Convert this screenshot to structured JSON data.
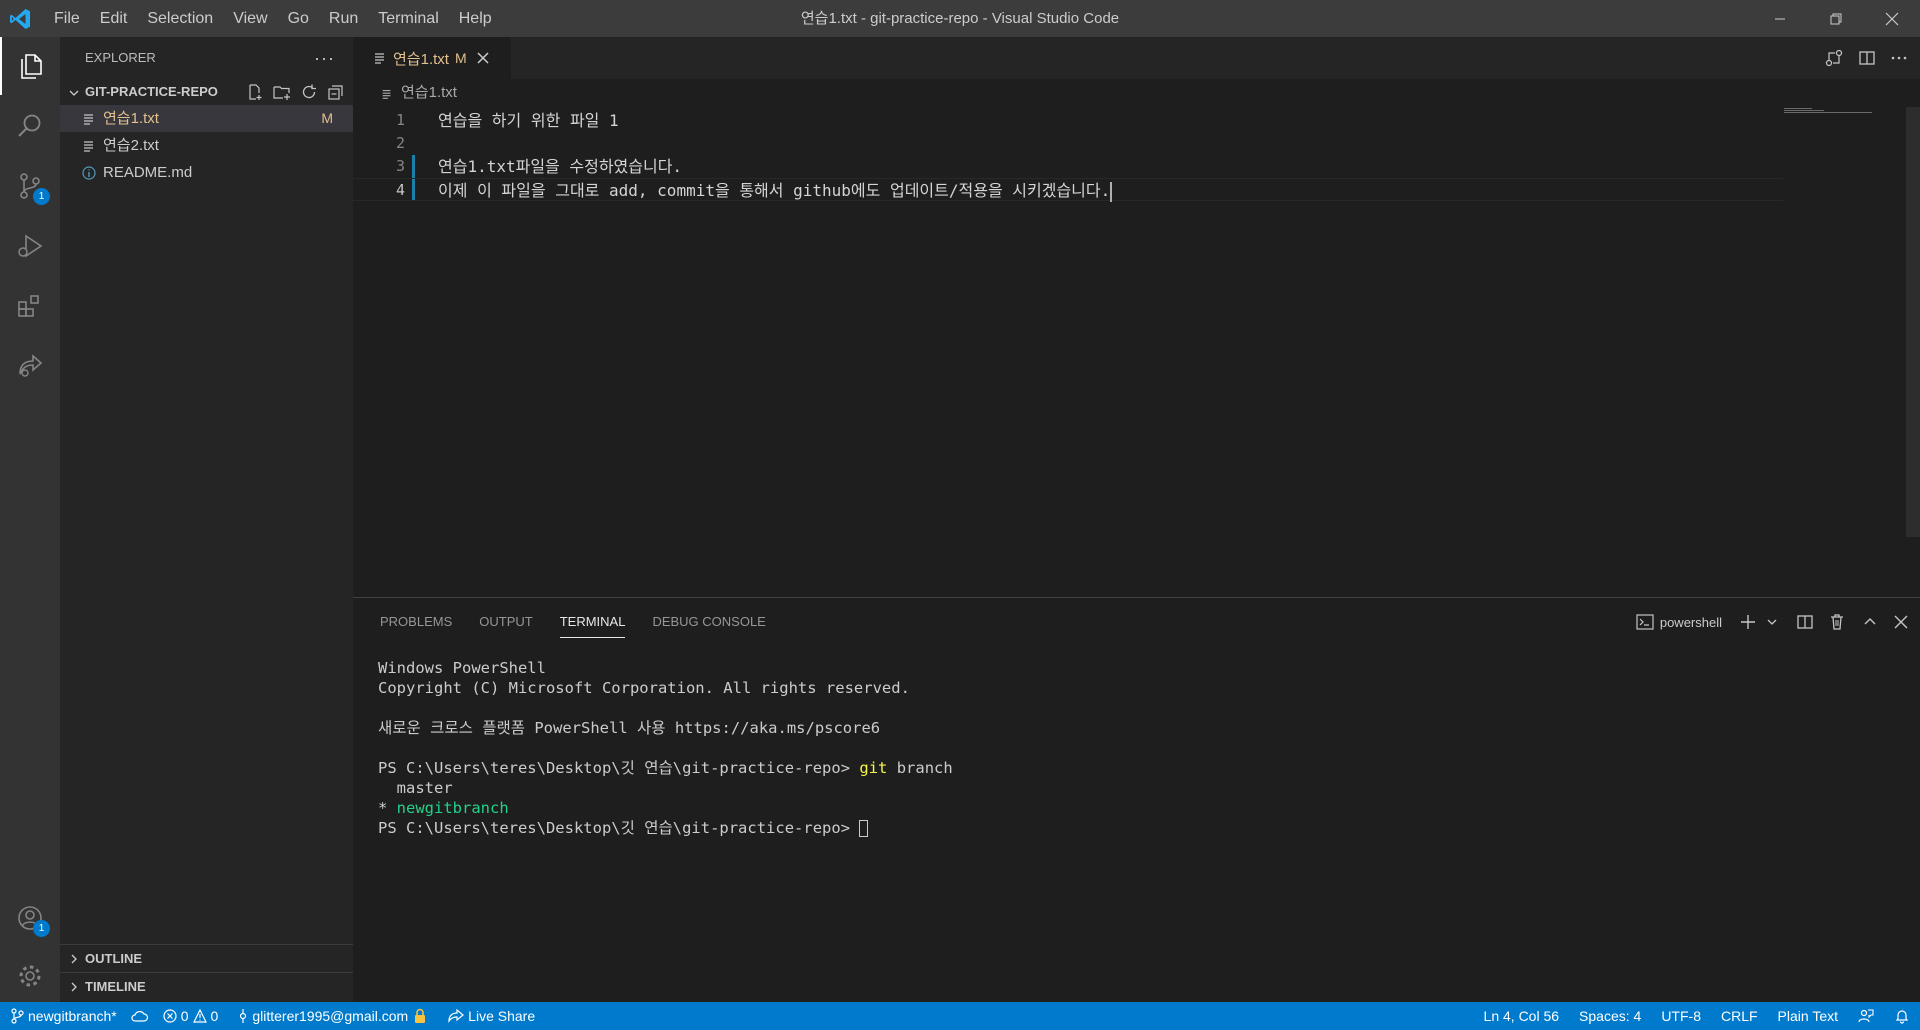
{
  "title": "연습1.txt - git-practice-repo - Visual Studio Code",
  "menu": [
    "File",
    "Edit",
    "Selection",
    "View",
    "Go",
    "Run",
    "Terminal",
    "Help"
  ],
  "activity": {
    "scm_badge": "1",
    "accounts_badge": "1"
  },
  "sidebar": {
    "header": "EXPLORER",
    "more": "···",
    "folder": "GIT-PRACTICE-REPO",
    "files": [
      {
        "name": "연습1.txt",
        "status": "M"
      },
      {
        "name": "연습2.txt",
        "status": ""
      },
      {
        "name": "README.md",
        "status": ""
      }
    ],
    "outline": "OUTLINE",
    "timeline": "TIMELINE"
  },
  "editor": {
    "tab": {
      "name": "연습1.txt",
      "status": "M"
    },
    "breadcrumb": "연습1.txt",
    "lines": [
      {
        "num": "1",
        "text": "연습을 하기 위한 파일 1"
      },
      {
        "num": "2",
        "text": ""
      },
      {
        "num": "3",
        "text": "연습1.txt파일을 수정하였습니다."
      },
      {
        "num": "4",
        "text": "이제 이 파일을 그대로 add, commit을 통해서 github에도 업데이트/적용을 시키겠습니다."
      }
    ]
  },
  "panel": {
    "tabs": [
      "PROBLEMS",
      "OUTPUT",
      "TERMINAL",
      "DEBUG CONSOLE"
    ],
    "active_tab": "TERMINAL",
    "shell": "powershell",
    "terminal": {
      "l1": "Windows PowerShell",
      "l2": "Copyright (C) Microsoft Corporation. All rights reserved.",
      "l3": "새로운 크로스 플랫폼 PowerShell 사용 https://aka.ms/pscore6",
      "prompt": "PS C:\\Users\\teres\\Desktop\\깃 연습\\git-practice-repo> ",
      "cmd_git": "git",
      "cmd_rest": " branch",
      "branch_master": "  master",
      "branch_star": "* ",
      "branch_new": "newgitbranch",
      "prompt2": "PS C:\\Users\\teres\\Desktop\\깃 연습\\git-practice-repo> "
    }
  },
  "status": {
    "branch": "newgitbranch*",
    "errors": "0",
    "warnings": "0",
    "account": "glitterer1995@gmail.com",
    "liveshare": "Live Share",
    "position": "Ln 4, Col 56",
    "spaces": "Spaces: 4",
    "encoding": "UTF-8",
    "eol": "CRLF",
    "language": "Plain Text"
  },
  "colors": {
    "accent": "#007acc",
    "modified": "#e2c08d",
    "terminal_yellow": "#f5f543",
    "terminal_green": "#23d18b"
  }
}
